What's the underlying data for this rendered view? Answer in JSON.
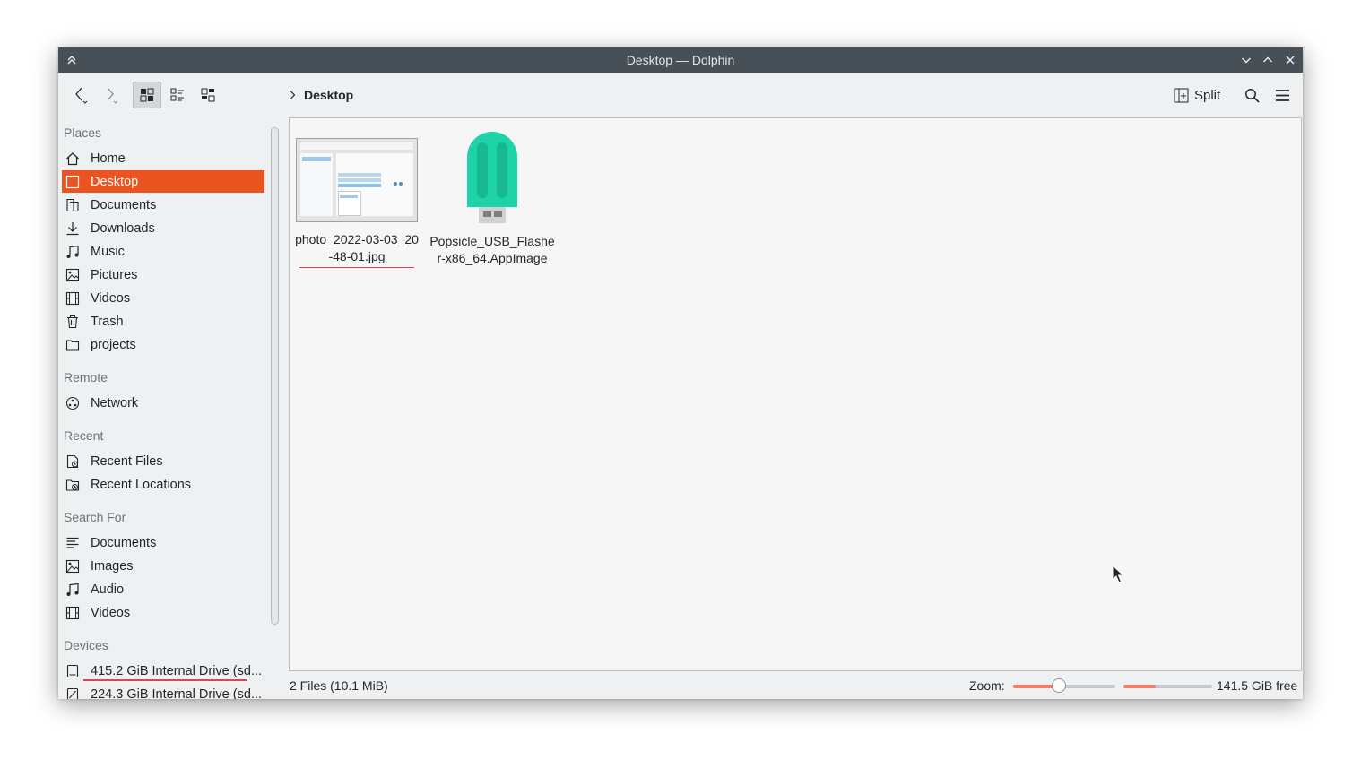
{
  "window": {
    "title": "Desktop — Dolphin"
  },
  "toolbar": {
    "back_icon": "arrow-left-icon",
    "forward_icon": "arrow-right-icon",
    "view_modes": [
      "icons-view-icon",
      "details-view-icon",
      "compact-view-icon"
    ],
    "split_label": "Split"
  },
  "breadcrumb": {
    "current": "Desktop"
  },
  "sidebar": {
    "places_header": "Places",
    "places": [
      {
        "label": "Home",
        "icon": "home-icon"
      },
      {
        "label": "Desktop",
        "icon": "desktop-icon",
        "active": true
      },
      {
        "label": "Documents",
        "icon": "documents-icon"
      },
      {
        "label": "Downloads",
        "icon": "downloads-icon"
      },
      {
        "label": "Music",
        "icon": "music-icon"
      },
      {
        "label": "Pictures",
        "icon": "pictures-icon"
      },
      {
        "label": "Videos",
        "icon": "videos-icon"
      },
      {
        "label": "Trash",
        "icon": "trash-icon"
      },
      {
        "label": "projects",
        "icon": "folder-icon"
      }
    ],
    "remote_header": "Remote",
    "remote": [
      {
        "label": "Network",
        "icon": "network-icon"
      }
    ],
    "recent_header": "Recent",
    "recent": [
      {
        "label": "Recent Files",
        "icon": "recent-files-icon"
      },
      {
        "label": "Recent Locations",
        "icon": "recent-locations-icon"
      }
    ],
    "search_header": "Search For",
    "search": [
      {
        "label": "Documents",
        "icon": "text-document-icon"
      },
      {
        "label": "Images",
        "icon": "image-icon"
      },
      {
        "label": "Audio",
        "icon": "audio-icon"
      },
      {
        "label": "Videos",
        "icon": "video-icon"
      }
    ],
    "devices_header": "Devices",
    "devices": [
      {
        "label": "415.2 GiB Internal Drive (sd...",
        "icon": "drive-icon",
        "usage": 0.95
      },
      {
        "label": "224.3 GiB Internal Drive (sd...",
        "icon": "drive-icon"
      }
    ]
  },
  "files": [
    {
      "name": "photo_2022-03-03_20-48-01.jpg",
      "type": "image-thumbnail"
    },
    {
      "name": "Popsicle_USB_Flasher-x86_64.AppImage",
      "type": "popsicle-icon"
    }
  ],
  "status": {
    "summary": "2 Files (10.1 MiB)",
    "zoom_label": "Zoom:",
    "zoom_level": 0.45,
    "disk_used_fraction": 0.36,
    "free_space": "141.5 GiB free"
  },
  "colors": {
    "accent": "#e95420",
    "titlebar": "#475057",
    "popsicle": "#1dd3a7"
  }
}
